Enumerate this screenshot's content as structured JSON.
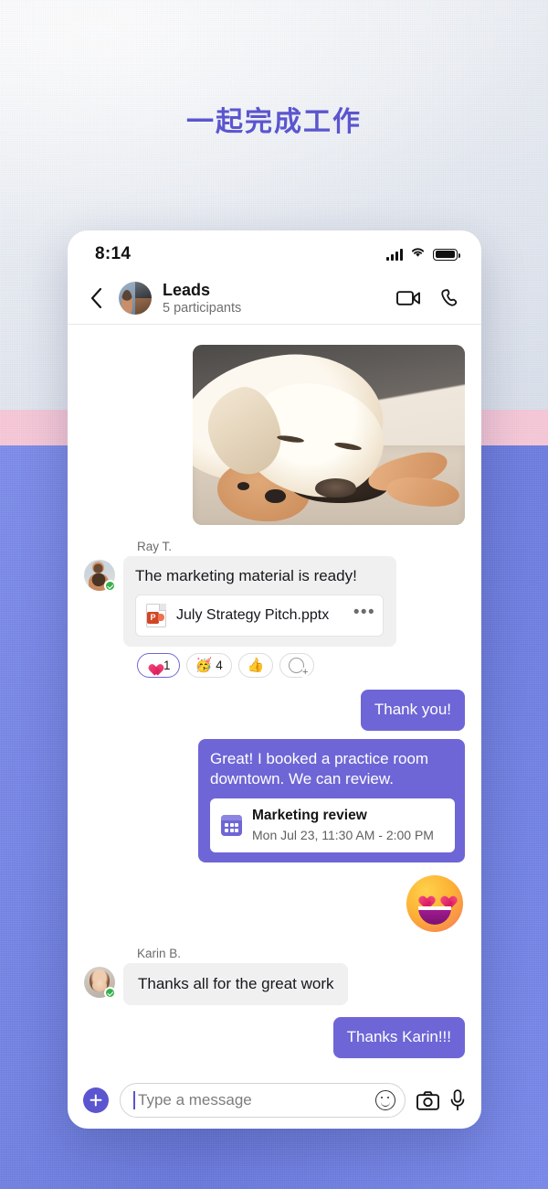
{
  "headline": "一起完成工作",
  "theme": {
    "accent_purple": "#6e66d6",
    "headline_purple": "#5b55cf",
    "band_top": "#e3e8f0",
    "band_pink": "#f7c8d8",
    "band_blue": "#6e7fe8",
    "incoming_bubble": "#f0f0f0",
    "presence_green": "#35b14a",
    "powerpoint_red": "#d24625"
  },
  "status_bar": {
    "time": "8:14",
    "signal_icon": "cellular-signal-icon",
    "wifi_icon": "wifi-icon",
    "battery_icon": "battery-full-icon"
  },
  "chat_header": {
    "back_icon": "chevron-left-icon",
    "avatar": "group-avatar",
    "title": "Leads",
    "subtitle": "5 participants",
    "video_call_icon": "video-camera-icon",
    "audio_call_icon": "phone-icon"
  },
  "messages": [
    {
      "type": "image",
      "direction": "incoming",
      "alt": "Sleeping yellow labrador with plush toy"
    },
    {
      "type": "text_with_file",
      "direction": "incoming",
      "sender": "Ray T.",
      "avatar": "ray-avatar",
      "presence": "available",
      "text": "The marketing material is ready!",
      "file": {
        "icon": "powerpoint-file-icon",
        "name": "July Strategy Pitch.pptx",
        "more_icon": "more-options-icon"
      },
      "reactions": [
        {
          "emoji": "heart",
          "label": "❤",
          "count": "1",
          "selected": true
        },
        {
          "emoji": "party-face",
          "label": "🥳",
          "count": "4",
          "selected": false
        },
        {
          "emoji": "thumbs-up",
          "label": "👍",
          "count": "",
          "selected": false
        },
        {
          "emoji": "add-reaction",
          "label": "",
          "count": "",
          "selected": false
        }
      ]
    },
    {
      "type": "text",
      "direction": "outgoing",
      "text": "Thank you!"
    },
    {
      "type": "text_with_event",
      "direction": "outgoing",
      "text": "Great! I booked a practice room downtown. We can review.",
      "event": {
        "icon": "calendar-icon",
        "title": "Marketing review",
        "time": "Mon Jul 23, 11:30 AM - 2:00 PM"
      }
    },
    {
      "type": "sticker",
      "direction": "outgoing",
      "sticker": "heart-eyes-emoji"
    },
    {
      "type": "text",
      "direction": "incoming",
      "sender": "Karin B.",
      "avatar": "karin-avatar",
      "presence": "available",
      "text": "Thanks all for the great work"
    },
    {
      "type": "text",
      "direction": "outgoing",
      "text": "Thanks Karin!!!"
    }
  ],
  "composer": {
    "add_icon": "plus-icon",
    "placeholder": "Type a message",
    "value": "",
    "emoji_icon": "emoji-smiley-icon",
    "camera_icon": "camera-icon",
    "mic_icon": "microphone-icon"
  }
}
